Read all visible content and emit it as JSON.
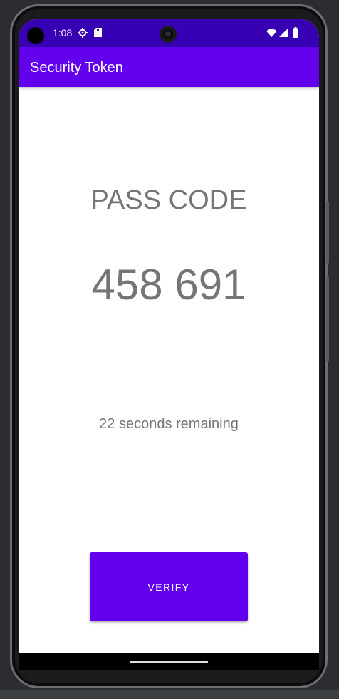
{
  "status_bar": {
    "time": "1:08",
    "icons": [
      "settings-gear-icon",
      "sd-card-icon",
      "wifi-icon",
      "cell-signal-icon",
      "battery-icon"
    ],
    "color": "#3700b3"
  },
  "app_bar": {
    "title": "Security Token",
    "color": "#6200ee"
  },
  "token": {
    "label": "PASS CODE",
    "code": "458 691",
    "remaining_text": "22 seconds remaining"
  },
  "actions": {
    "verify_label": "VERIFY"
  },
  "colors": {
    "primary": "#6200ee",
    "primary_dark": "#3700b3",
    "text_secondary": "#757575"
  }
}
